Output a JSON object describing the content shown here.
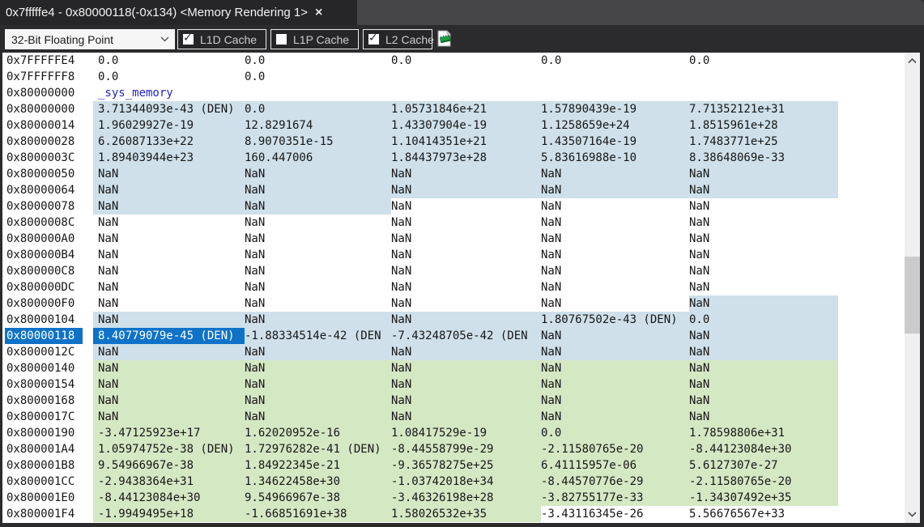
{
  "tab": {
    "title": "0x7fffffe4 - 0x80000118(-0x134) <Memory Rendering 1>",
    "close_glyph": "×"
  },
  "toolbar": {
    "format_select": {
      "value": "32-Bit Floating Point"
    },
    "checkboxes": [
      {
        "label": "L1D Cache",
        "checked": true
      },
      {
        "label": "L1P Cache",
        "checked": false
      },
      {
        "label": "L2 Cache",
        "checked": true
      }
    ],
    "check_glyph": "✓",
    "memory_save_icon": "chip-on-page"
  },
  "colors": {
    "selection_blue": "#0e72c8",
    "l1d_cache_highlight_blue": "#cfe0ea",
    "l2_cache_highlight_green": "#d5e8c4",
    "symbol_blue": "#2323cc"
  },
  "memory": {
    "columns_per_row": 5,
    "rows": [
      {
        "address": "0x7FFFFFE4",
        "values": [
          "0.0",
          "0.0",
          "0.0",
          "0.0",
          "0.0"
        ],
        "hl": [
          "w",
          "w",
          "w",
          "w",
          "w"
        ]
      },
      {
        "address": "0x7FFFFFF8",
        "values": [
          "0.0",
          "0.0",
          "",
          "",
          ""
        ],
        "hl": [
          "w",
          "w",
          "w",
          "w",
          "w"
        ]
      },
      {
        "address": "0x80000000",
        "label": "_sys_memory"
      },
      {
        "address": "0x80000000",
        "values": [
          "3.71344093e-43 (DEN)",
          "0.0",
          "1.05731846e+21",
          "1.57890439e-19",
          "7.71352121e+31"
        ],
        "hl": [
          "b",
          "b",
          "b",
          "b",
          "b"
        ]
      },
      {
        "address": "0x80000014",
        "values": [
          "1.96029927e-19",
          "12.8291674",
          "1.43307904e-19",
          "1.1258659e+24",
          "1.8515961e+28"
        ],
        "hl": [
          "b",
          "b",
          "b",
          "b",
          "b"
        ]
      },
      {
        "address": "0x80000028",
        "values": [
          "6.26087133e+22",
          "8.9070351e-15",
          "1.10414351e+21",
          "1.43507164e-19",
          "1.7483771e+25"
        ],
        "hl": [
          "b",
          "b",
          "b",
          "b",
          "b"
        ]
      },
      {
        "address": "0x8000003C",
        "values": [
          "1.89403944e+23",
          "160.447006",
          "1.84437973e+28",
          "5.83616988e-10",
          "8.38648069e-33"
        ],
        "hl": [
          "b",
          "b",
          "b",
          "b",
          "b"
        ]
      },
      {
        "address": "0x80000050",
        "values": [
          "NaN",
          "NaN",
          "NaN",
          "NaN",
          "NaN"
        ],
        "hl": [
          "b",
          "b",
          "b",
          "b",
          "b"
        ]
      },
      {
        "address": "0x80000064",
        "values": [
          "NaN",
          "NaN",
          "NaN",
          "NaN",
          "NaN"
        ],
        "hl": [
          "b",
          "b",
          "b",
          "b",
          "b"
        ]
      },
      {
        "address": "0x80000078",
        "values": [
          "NaN",
          "NaN",
          "NaN",
          "NaN",
          "NaN"
        ],
        "hl": [
          "b",
          "b",
          "w",
          "w",
          "w"
        ]
      },
      {
        "address": "0x8000008C",
        "values": [
          "NaN",
          "NaN",
          "NaN",
          "NaN",
          "NaN"
        ],
        "hl": [
          "w",
          "w",
          "w",
          "w",
          "w"
        ]
      },
      {
        "address": "0x800000A0",
        "values": [
          "NaN",
          "NaN",
          "NaN",
          "NaN",
          "NaN"
        ],
        "hl": [
          "w",
          "w",
          "w",
          "w",
          "w"
        ]
      },
      {
        "address": "0x800000B4",
        "values": [
          "NaN",
          "NaN",
          "NaN",
          "NaN",
          "NaN"
        ],
        "hl": [
          "w",
          "w",
          "w",
          "w",
          "w"
        ]
      },
      {
        "address": "0x800000C8",
        "values": [
          "NaN",
          "NaN",
          "NaN",
          "NaN",
          "NaN"
        ],
        "hl": [
          "w",
          "w",
          "w",
          "w",
          "w"
        ]
      },
      {
        "address": "0x800000DC",
        "values": [
          "NaN",
          "NaN",
          "NaN",
          "NaN",
          "NaN"
        ],
        "hl": [
          "w",
          "w",
          "w",
          "w",
          "w"
        ]
      },
      {
        "address": "0x800000F0",
        "values": [
          "NaN",
          "NaN",
          "NaN",
          "NaN",
          "NaN"
        ],
        "hl": [
          "w",
          "w",
          "w",
          "w",
          "b"
        ]
      },
      {
        "address": "0x80000104",
        "values": [
          "NaN",
          "NaN",
          "NaN",
          "1.80767502e-43 (DEN)",
          "0.0"
        ],
        "hl": [
          "b",
          "b",
          "b",
          "b",
          "b"
        ]
      },
      {
        "address": "0x80000118",
        "address_selected": true,
        "values": [
          "8.40779079e-45 (DEN)",
          "-1.88334514e-42 (DEN",
          "-7.43248705e-42 (DEN",
          "NaN",
          "NaN"
        ],
        "hl": [
          "s",
          "b",
          "b",
          "b",
          "b"
        ]
      },
      {
        "address": "0x8000012C",
        "values": [
          "NaN",
          "NaN",
          "NaN",
          "NaN",
          "NaN"
        ],
        "hl": [
          "b",
          "b",
          "b",
          "b",
          "b"
        ]
      },
      {
        "address": "0x80000140",
        "values": [
          "NaN",
          "NaN",
          "NaN",
          "NaN",
          "NaN"
        ],
        "hl": [
          "g",
          "g",
          "g",
          "g",
          "g"
        ]
      },
      {
        "address": "0x80000154",
        "values": [
          "NaN",
          "NaN",
          "NaN",
          "NaN",
          "NaN"
        ],
        "hl": [
          "g",
          "g",
          "g",
          "g",
          "g"
        ]
      },
      {
        "address": "0x80000168",
        "values": [
          "NaN",
          "NaN",
          "NaN",
          "NaN",
          "NaN"
        ],
        "hl": [
          "g",
          "g",
          "g",
          "g",
          "g"
        ]
      },
      {
        "address": "0x8000017C",
        "values": [
          "NaN",
          "NaN",
          "NaN",
          "NaN",
          "NaN"
        ],
        "hl": [
          "g",
          "g",
          "g",
          "g",
          "g"
        ]
      },
      {
        "address": "0x80000190",
        "values": [
          "-3.47125923e+17",
          "1.62020952e-16",
          "1.08417529e-19",
          "0.0",
          "1.78598806e+31"
        ],
        "hl": [
          "g",
          "g",
          "g",
          "g",
          "g"
        ]
      },
      {
        "address": "0x800001A4",
        "values": [
          "1.05974752e-38 (DEN)",
          "1.72976282e-41 (DEN)",
          "-8.44558799e-29",
          "-2.11580765e-20",
          "-8.44123084e+30"
        ],
        "hl": [
          "g",
          "g",
          "g",
          "g",
          "g"
        ]
      },
      {
        "address": "0x800001B8",
        "values": [
          "9.54966967e-38",
          "1.84922345e-21",
          "-9.36578275e+25",
          "6.41115957e-06",
          "5.6127307e-27"
        ],
        "hl": [
          "g",
          "g",
          "g",
          "g",
          "g"
        ]
      },
      {
        "address": "0x800001CC",
        "values": [
          "-2.9438364e+31",
          "1.34622458e+30",
          "-1.03742018e+34",
          "-8.44570776e-29",
          "-2.11580765e-20"
        ],
        "hl": [
          "g",
          "g",
          "g",
          "g",
          "g"
        ]
      },
      {
        "address": "0x800001E0",
        "values": [
          "-8.44123084e+30",
          "9.54966967e-38",
          "-3.46326198e+28",
          "-3.82755177e-33",
          "-1.34307492e+35"
        ],
        "hl": [
          "g",
          "g",
          "g",
          "g",
          "g"
        ]
      },
      {
        "address": "0x800001F4",
        "values": [
          "-1.9949495e+18",
          "-1.66851691e+38",
          "1.58026532e+35",
          "-3.43116345e-26",
          "5.56676567e+33"
        ],
        "hl": [
          "g",
          "g",
          "g",
          "w",
          "w"
        ]
      }
    ]
  }
}
